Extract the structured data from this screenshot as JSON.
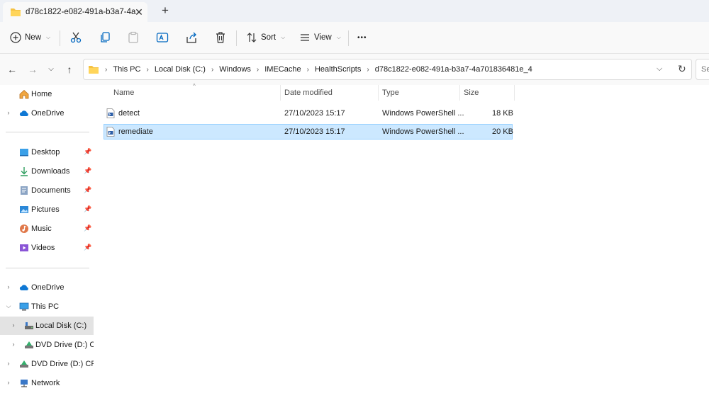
{
  "window": {
    "tab_title": "d78c1822-e082-491a-b3a7-4a",
    "close_glyph": "✕",
    "new_tab_glyph": "+"
  },
  "toolbar": {
    "new_label": "New",
    "sort_label": "Sort",
    "view_label": "View",
    "more_glyph": "•••"
  },
  "address": {
    "crumbs": [
      "This PC",
      "Local Disk (C:)",
      "Windows",
      "IMECache",
      "HealthScripts",
      "d78c1822-e082-491a-b3a7-4a701836481e_4"
    ],
    "search_placeholder": "Se"
  },
  "sidebar": {
    "quick": [
      {
        "label": "Home",
        "icon": "home-icon"
      },
      {
        "label": "OneDrive",
        "icon": "cloud-icon"
      }
    ],
    "pinned": [
      {
        "label": "Desktop",
        "icon": "desktop-icon"
      },
      {
        "label": "Downloads",
        "icon": "download-icon"
      },
      {
        "label": "Documents",
        "icon": "documents-icon"
      },
      {
        "label": "Pictures",
        "icon": "pictures-icon"
      },
      {
        "label": "Music",
        "icon": "music-icon"
      },
      {
        "label": "Videos",
        "icon": "videos-icon"
      }
    ],
    "tree": [
      {
        "label": "OneDrive",
        "icon": "cloud-icon"
      },
      {
        "label": "This PC",
        "icon": "computer-icon"
      },
      {
        "label": "Local Disk (C:)",
        "icon": "drive-icon"
      },
      {
        "label": "DVD Drive (D:) CP",
        "icon": "dvd-icon"
      },
      {
        "label": "DVD Drive (D:) CPB/",
        "icon": "dvd-icon"
      },
      {
        "label": "Network",
        "icon": "network-icon"
      }
    ]
  },
  "columns": {
    "name": "Name",
    "date": "Date modified",
    "type": "Type",
    "size": "Size"
  },
  "files": [
    {
      "name": "detect",
      "date": "27/10/2023 15:17",
      "type": "Windows PowerShell ...",
      "size": "18 KB",
      "selected": false
    },
    {
      "name": "remediate",
      "date": "27/10/2023 15:17",
      "type": "Windows PowerShell ...",
      "size": "20 KB",
      "selected": true
    }
  ],
  "colors": {
    "accent": "#0067c0",
    "selection_bg": "#cce8ff",
    "folder_yellow": "#f5c242"
  }
}
